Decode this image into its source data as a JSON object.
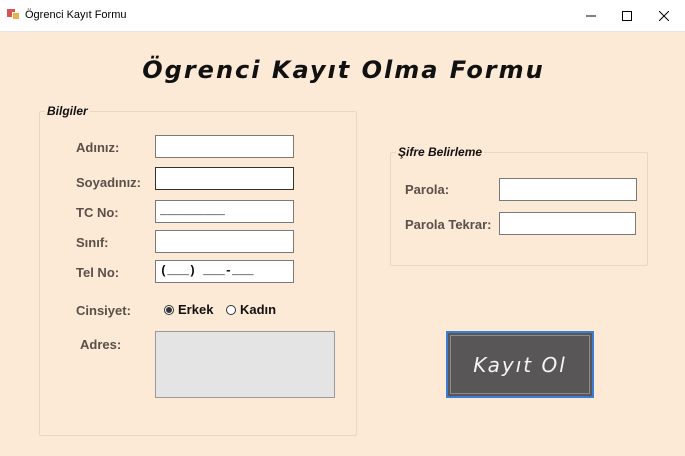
{
  "window": {
    "title": "Ögrenci Kayıt Formu"
  },
  "form": {
    "heading": "Ögrenci Kayıt Olma Formu"
  },
  "bilgiler": {
    "legend": "Bilgiler",
    "labels": {
      "ad": "Adınız:",
      "soyad": "Soyadınız:",
      "tc": "TC No:",
      "sinif": "Sınıf:",
      "tel": "Tel No:",
      "cinsiyet": "Cinsiyet:",
      "adres": "Adres:"
    },
    "values": {
      "ad": "",
      "soyad": "",
      "tc_mask": "_________",
      "sinif": "",
      "tel_mask": "(___) ___-___"
    },
    "gender": {
      "male": "Erkek",
      "female": "Kadın",
      "selected": "Erkek"
    }
  },
  "sifre": {
    "legend": "Şifre Belirleme",
    "labels": {
      "parola": "Parola:",
      "parola_tekrar": "Parola Tekrar:"
    }
  },
  "submit_label": "Kayıt Ol"
}
